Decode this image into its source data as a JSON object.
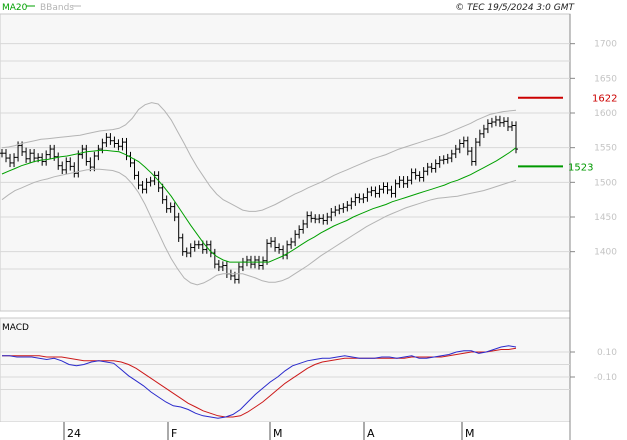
{
  "header": {
    "legend_ma": "MA20",
    "legend_bands": "BBands",
    "copyright": "© TEC 19/5/2024 3:0 GMT"
  },
  "colors": {
    "background": "#ffffff",
    "plot_bg": "#f7f7f7",
    "grid": "#d8d8d8",
    "price_bars": "#000000",
    "ma20": "#00a000",
    "bbands": "#b4b4b4",
    "macd": "#2a2acc",
    "signal": "#cc1a1a",
    "resistance_marker": "#cc0000",
    "support_marker": "#009900"
  },
  "chart_data": [
    {
      "type": "line",
      "x_tick_labels": [
        "24",
        "F",
        "M",
        "A",
        "M"
      ],
      "y_tick_labels": [
        "1700",
        "1650",
        "1600",
        "1550",
        "1500",
        "1450",
        "1400"
      ],
      "ylim": [
        1350,
        1720
      ],
      "grid": true,
      "legend": "top-left",
      "series": [
        {
          "name": "MA20",
          "values": [
            1512,
            1516,
            1520,
            1524,
            1527,
            1530,
            1532,
            1533,
            1535,
            1537,
            1538,
            1540,
            1542,
            1544,
            1545,
            1546,
            1546,
            1545,
            1544,
            1540,
            1535,
            1530,
            1522,
            1513,
            1503,
            1492,
            1480,
            1466,
            1452,
            1438,
            1425,
            1412,
            1401,
            1393,
            1388,
            1385,
            1385,
            1385,
            1385,
            1385,
            1385,
            1385,
            1389,
            1393,
            1398,
            1404,
            1410,
            1416,
            1421,
            1427,
            1432,
            1437,
            1441,
            1445,
            1450,
            1454,
            1458,
            1462,
            1465,
            1468,
            1472,
            1475,
            1478,
            1481,
            1484,
            1487,
            1490,
            1493,
            1496,
            1500,
            1503,
            1507,
            1511,
            1516,
            1521,
            1526,
            1531,
            1537,
            1543,
            1550
          ]
        },
        {
          "name": "BBands",
          "values": [
            1475,
            1482,
            1488,
            1492,
            1496,
            1500,
            1503,
            1505,
            1508,
            1510,
            1512,
            1514,
            1516,
            1518,
            1519,
            1519,
            1518,
            1517,
            1514,
            1508,
            1498,
            1485,
            1468,
            1448,
            1428,
            1408,
            1390,
            1375,
            1362,
            1355,
            1352,
            1355,
            1360,
            1366,
            1368,
            1368,
            1368,
            1368,
            1365,
            1362,
            1358,
            1356,
            1356,
            1358,
            1362,
            1368,
            1374,
            1380,
            1387,
            1394,
            1400,
            1406,
            1412,
            1418,
            1424,
            1430,
            1436,
            1441,
            1446,
            1451,
            1455,
            1459,
            1463,
            1466,
            1469,
            1472,
            1475,
            1477,
            1478,
            1479,
            1480,
            1482,
            1484,
            1486,
            1488,
            1491,
            1494,
            1497,
            1500,
            1503
          ]
        },
        {
          "name": "",
          "values": [
            1550,
            1551,
            1553,
            1556,
            1558,
            1560,
            1562,
            1563,
            1564,
            1565,
            1566,
            1567,
            1568,
            1570,
            1572,
            1574,
            1575,
            1576,
            1578,
            1583,
            1592,
            1605,
            1612,
            1615,
            1613,
            1603,
            1590,
            1573,
            1556,
            1538,
            1522,
            1508,
            1494,
            1483,
            1475,
            1470,
            1465,
            1460,
            1458,
            1458,
            1460,
            1464,
            1468,
            1473,
            1478,
            1483,
            1487,
            1492,
            1496,
            1500,
            1505,
            1510,
            1514,
            1518,
            1522,
            1526,
            1530,
            1534,
            1537,
            1540,
            1544,
            1548,
            1551,
            1554,
            1557,
            1560,
            1563,
            1566,
            1569,
            1573,
            1577,
            1581,
            1585,
            1590,
            1594,
            1598,
            1600,
            1602,
            1603,
            1604
          ]
        },
        {
          "name": "",
          "type": "ohlc",
          "values": [
            1542,
            1535,
            1528,
            1536,
            1553,
            1544,
            1534,
            1542,
            1535,
            1536,
            1530,
            1540,
            1548,
            1537,
            1524,
            1518,
            1530,
            1523,
            1513,
            1540,
            1548,
            1530,
            1522,
            1538,
            1548,
            1557,
            1565,
            1560,
            1556,
            1552,
            1558,
            1538,
            1528,
            1510,
            1496,
            1490,
            1500,
            1502,
            1510,
            1492,
            1475,
            1462,
            1465,
            1450,
            1420,
            1400,
            1398,
            1406,
            1410,
            1410,
            1403,
            1410,
            1398,
            1382,
            1378,
            1380,
            1368,
            1365,
            1360,
            1378,
            1385,
            1388,
            1382,
            1388,
            1380,
            1387,
            1412,
            1415,
            1406,
            1403,
            1395,
            1410,
            1414,
            1425,
            1432,
            1440,
            1452,
            1448,
            1447,
            1448,
            1445,
            1450,
            1457,
            1460,
            1462,
            1464,
            1467,
            1472,
            1478,
            1476,
            1478,
            1486,
            1488,
            1484,
            1490,
            1494,
            1489,
            1484,
            1498,
            1503,
            1498,
            1503,
            1514,
            1510,
            1507,
            1516,
            1522,
            1520,
            1527,
            1532,
            1533,
            1535,
            1541,
            1548,
            1556,
            1560,
            1545,
            1530,
            1558,
            1570,
            1577,
            1585,
            1587,
            1590,
            1586,
            1588,
            1580,
            1582,
            1548
          ]
        }
      ]
    },
    {
      "type": "line",
      "title": "MACD",
      "y_tick_labels": [
        "0.10",
        "-0.10"
      ],
      "ylim": [
        -0.5,
        0.25
      ],
      "grid": true,
      "series": [
        {
          "name": "",
          "values": [
            0.07,
            0.07,
            0.06,
            0.06,
            0.06,
            0.05,
            0.04,
            0.05,
            0.03,
            0.0,
            -0.01,
            0.0,
            0.02,
            0.03,
            0.02,
            0.01,
            -0.04,
            -0.09,
            -0.13,
            -0.17,
            -0.22,
            -0.26,
            -0.3,
            -0.33,
            -0.34,
            -0.36,
            -0.39,
            -0.41,
            -0.42,
            -0.43,
            -0.42,
            -0.4,
            -0.36,
            -0.3,
            -0.24,
            -0.19,
            -0.14,
            -0.1,
            -0.05,
            -0.01,
            0.01,
            0.03,
            0.04,
            0.05,
            0.05,
            0.06,
            0.07,
            0.06,
            0.05,
            0.05,
            0.05,
            0.06,
            0.06,
            0.05,
            0.06,
            0.07,
            0.05,
            0.05,
            0.06,
            0.07,
            0.08,
            0.1,
            0.11,
            0.11,
            0.09,
            0.1,
            0.12,
            0.14,
            0.15,
            0.14
          ]
        },
        {
          "name": "",
          "values": [
            0.07,
            0.07,
            0.07,
            0.07,
            0.07,
            0.07,
            0.06,
            0.06,
            0.06,
            0.05,
            0.04,
            0.03,
            0.03,
            0.03,
            0.03,
            0.03,
            0.02,
            0.0,
            -0.03,
            -0.07,
            -0.11,
            -0.15,
            -0.19,
            -0.23,
            -0.27,
            -0.31,
            -0.34,
            -0.37,
            -0.39,
            -0.41,
            -0.42,
            -0.42,
            -0.41,
            -0.38,
            -0.34,
            -0.3,
            -0.25,
            -0.2,
            -0.15,
            -0.11,
            -0.07,
            -0.03,
            0.0,
            0.02,
            0.03,
            0.04,
            0.05,
            0.05,
            0.05,
            0.05,
            0.05,
            0.05,
            0.05,
            0.05,
            0.05,
            0.06,
            0.06,
            0.06,
            0.06,
            0.06,
            0.07,
            0.08,
            0.09,
            0.1,
            0.1,
            0.1,
            0.11,
            0.12,
            0.12,
            0.13
          ]
        }
      ]
    }
  ],
  "markers": {
    "resistance": 1622,
    "support": 1523,
    "resistance_label": "1622",
    "support_label": "1523"
  }
}
